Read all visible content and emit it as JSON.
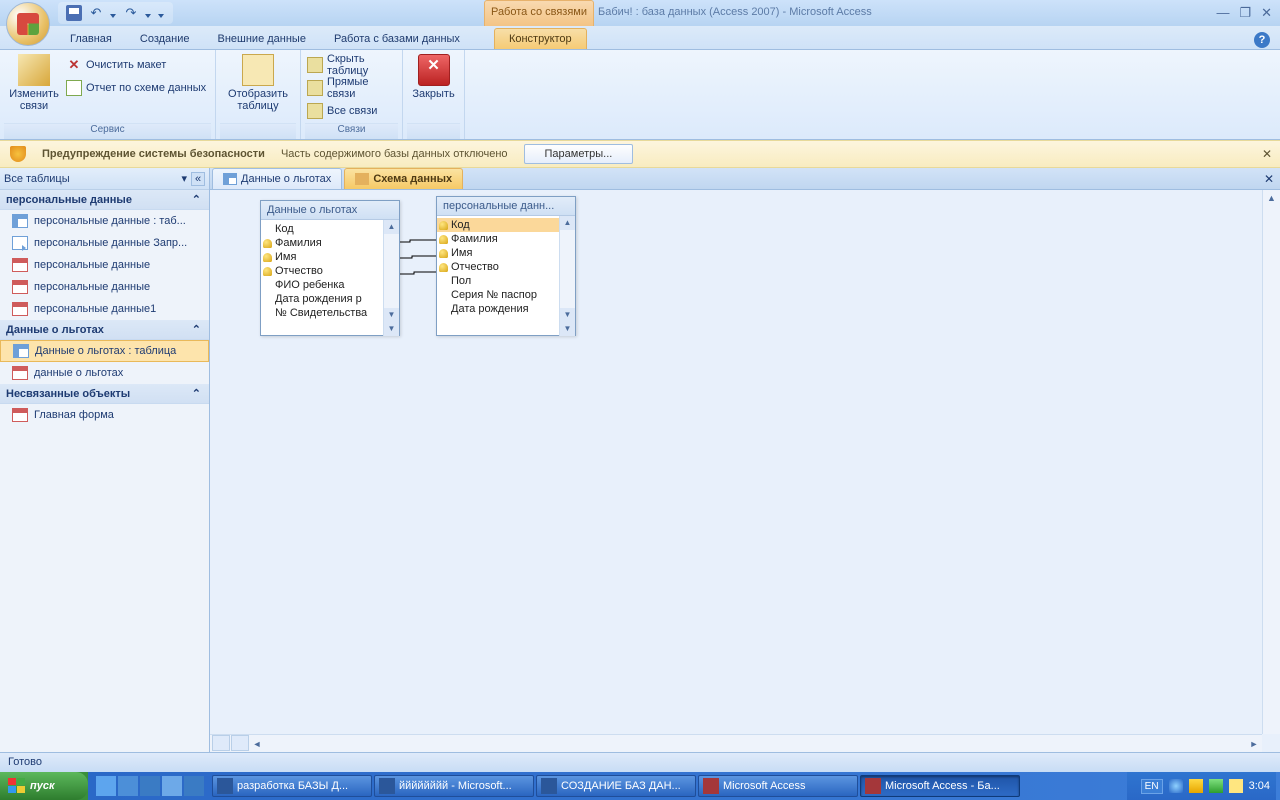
{
  "title": {
    "context_tab": "Работа со связями",
    "document": "Бабич! : база данных (Access 2007) - Microsoft Access"
  },
  "ribbon_tabs": [
    "Главная",
    "Создание",
    "Внешние данные",
    "Работа с базами данных",
    "Конструктор"
  ],
  "ribbon": {
    "group1": {
      "edit_rel": "Изменить связи",
      "clear_layout": "Очистить макет",
      "report": "Отчет по схеме данных",
      "label": "Сервис"
    },
    "group2": {
      "show_table": "Отобразить таблицу",
      "label": ""
    },
    "group3": {
      "hide": "Скрыть таблицу",
      "direct": "Прямые связи",
      "all": "Все связи",
      "label": "Связи"
    },
    "group4": {
      "close": "Закрыть",
      "label": ""
    }
  },
  "security": {
    "title": "Предупреждение системы безопасности",
    "msg": "Часть содержимого базы данных отключено",
    "btn": "Параметры..."
  },
  "nav": {
    "header": "Все таблицы",
    "groups": [
      {
        "title": "персональные данные",
        "items": [
          {
            "icon": "table",
            "label": "персональные данные : таб..."
          },
          {
            "icon": "query",
            "label": "персональные данные Запр..."
          },
          {
            "icon": "form",
            "label": "персональные данные"
          },
          {
            "icon": "form",
            "label": "персональные данные"
          },
          {
            "icon": "form",
            "label": "персональные данные1"
          }
        ]
      },
      {
        "title": "Данные о льготах",
        "items": [
          {
            "icon": "table",
            "label": "Данные о льготах : таблица",
            "selected": true
          },
          {
            "icon": "form",
            "label": "данные о льготах"
          }
        ]
      },
      {
        "title": "Несвязанные объекты",
        "items": [
          {
            "icon": "form",
            "label": "Главная форма"
          }
        ]
      }
    ]
  },
  "doctabs": [
    {
      "label": "Данные о льготах",
      "active": false
    },
    {
      "label": "Схема данных",
      "active": true
    }
  ],
  "tables": {
    "t1": {
      "title": "Данные о льготах",
      "fields": [
        {
          "n": "Код",
          "key": false
        },
        {
          "n": "Фамилия",
          "key": true
        },
        {
          "n": "Имя",
          "key": true
        },
        {
          "n": "Отчество",
          "key": true
        },
        {
          "n": "ФИО ребенка",
          "key": false
        },
        {
          "n": "Дата рождения р",
          "key": false
        },
        {
          "n": "№ Свидетельства",
          "key": false
        }
      ]
    },
    "t2": {
      "title": "персональные данн...",
      "fields": [
        {
          "n": "Код",
          "key": true,
          "sel": true
        },
        {
          "n": "Фамилия",
          "key": true
        },
        {
          "n": "Имя",
          "key": true
        },
        {
          "n": "Отчество",
          "key": true
        },
        {
          "n": "Пол",
          "key": false
        },
        {
          "n": "Серия № паспор",
          "key": false
        },
        {
          "n": "Дата рождения",
          "key": false
        }
      ]
    }
  },
  "status": "Готово",
  "taskbar": {
    "start": "пуск",
    "tasks": [
      {
        "label": "разработка БАЗЫ Д...",
        "icon": "word"
      },
      {
        "label": "йййййййй - Microsoft...",
        "icon": "word"
      },
      {
        "label": "СОЗДАНИЕ БАЗ ДАН...",
        "icon": "word"
      },
      {
        "label": "Microsoft Access",
        "icon": "access"
      },
      {
        "label": "Microsoft Access - Ба...",
        "icon": "access",
        "active": true
      }
    ],
    "lang": "EN",
    "time": "3:04"
  }
}
